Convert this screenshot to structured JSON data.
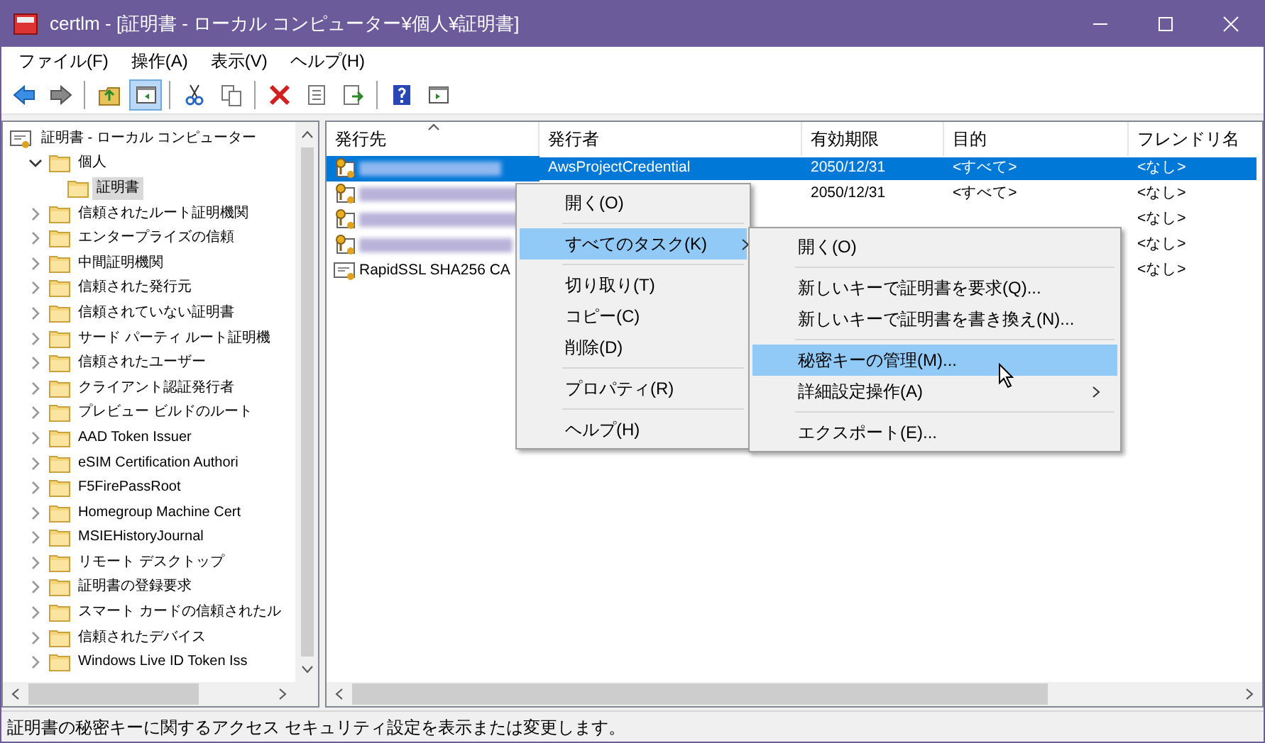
{
  "window": {
    "title": "certlm - [証明書 - ローカル コンピューター¥個人¥証明書]"
  },
  "menu_bar": [
    "ファイル(F)",
    "操作(A)",
    "表示(V)",
    "ヘルプ(H)"
  ],
  "toolbar": [
    {
      "kind": "back",
      "pressed": false
    },
    {
      "kind": "forward",
      "pressed": false
    },
    {
      "kind": "separator"
    },
    {
      "kind": "up",
      "pressed": false
    },
    {
      "kind": "tree",
      "pressed": true
    },
    {
      "kind": "separator"
    },
    {
      "kind": "cut",
      "pressed": false
    },
    {
      "kind": "copy",
      "pressed": false
    },
    {
      "kind": "separator"
    },
    {
      "kind": "delete",
      "pressed": false
    },
    {
      "kind": "properties",
      "pressed": false
    },
    {
      "kind": "export",
      "pressed": false
    },
    {
      "kind": "separator"
    },
    {
      "kind": "help",
      "pressed": false
    },
    {
      "kind": "action_pane",
      "pressed": false
    }
  ],
  "tree": [
    {
      "label": "証明書 - ローカル コンピューター",
      "kind": "root",
      "selected": false,
      "children": [
        {
          "label": "個人",
          "kind": "folder",
          "expanded": true,
          "selected": false,
          "children": [
            {
              "label": "証明書",
              "kind": "folder",
              "selected": true
            }
          ]
        },
        {
          "label": "信頼されたルート証明機関",
          "kind": "folder",
          "expanded": false,
          "selected": false
        },
        {
          "label": "エンタープライズの信頼",
          "kind": "folder",
          "expanded": false,
          "selected": false
        },
        {
          "label": "中間証明機関",
          "kind": "folder",
          "expanded": false,
          "selected": false
        },
        {
          "label": "信頼された発行元",
          "kind": "folder",
          "expanded": false,
          "selected": false
        },
        {
          "label": "信頼されていない証明書",
          "kind": "folder",
          "expanded": false,
          "selected": false
        },
        {
          "label": "サード パーティ ルート証明機",
          "kind": "folder",
          "expanded": false,
          "selected": false
        },
        {
          "label": "信頼されたユーザー",
          "kind": "folder",
          "expanded": false,
          "selected": false
        },
        {
          "label": "クライアント認証発行者",
          "kind": "folder",
          "expanded": false,
          "selected": false
        },
        {
          "label": "プレビュー ビルドのルート",
          "kind": "folder",
          "expanded": false,
          "selected": false
        },
        {
          "label": "AAD Token Issuer",
          "kind": "folder",
          "expanded": false,
          "selected": false
        },
        {
          "label": "eSIM Certification Authori",
          "kind": "folder",
          "expanded": false,
          "selected": false
        },
        {
          "label": "F5FirePassRoot",
          "kind": "folder",
          "expanded": false,
          "selected": false
        },
        {
          "label": "Homegroup Machine Cert",
          "kind": "folder",
          "expanded": false,
          "selected": false
        },
        {
          "label": "MSIEHistoryJournal",
          "kind": "folder",
          "expanded": false,
          "selected": false
        },
        {
          "label": "リモート デスクトップ",
          "kind": "folder",
          "expanded": false,
          "selected": false
        },
        {
          "label": "証明書の登録要求",
          "kind": "folder",
          "expanded": false,
          "selected": false
        },
        {
          "label": "スマート カードの信頼されたル",
          "kind": "folder",
          "expanded": false,
          "selected": false
        },
        {
          "label": "信頼されたデバイス",
          "kind": "folder",
          "expanded": false,
          "selected": false
        },
        {
          "label": "Windows Live ID Token Iss",
          "kind": "folder",
          "expanded": false,
          "selected": false
        }
      ]
    }
  ],
  "list": {
    "columns": [
      {
        "label": "発行先",
        "sorted": true
      },
      {
        "label": "発行者",
        "sorted": false
      },
      {
        "label": "有効期限",
        "sorted": false
      },
      {
        "label": "目的",
        "sorted": false
      },
      {
        "label": "フレンドリ名",
        "sorted": false
      }
    ],
    "rows": [
      {
        "selected": true,
        "has_private_key": true,
        "redacted": true,
        "issuer": "AwsProjectCredential",
        "expires": "2050/12/31",
        "purpose": "<すべて>",
        "friendly_name": "<なし>"
      },
      {
        "selected": false,
        "has_private_key": true,
        "redacted": true,
        "expires": "2050/12/31",
        "purpose": "<すべて>",
        "friendly_name": "<なし>"
      },
      {
        "selected": false,
        "has_private_key": true,
        "redacted": true,
        "friendly_name": "<なし>"
      },
      {
        "selected": false,
        "has_private_key": true,
        "redacted": true,
        "friendly_name": "<なし>"
      },
      {
        "selected": false,
        "has_private_key": false,
        "redacted": false,
        "issued_to": "RapidSSL SHA256 CA",
        "friendly_name": "<なし>"
      }
    ]
  },
  "context_menu": [
    {
      "kind": "item",
      "label": "開く(O)",
      "selected": false,
      "submenu": false
    },
    {
      "kind": "separator"
    },
    {
      "kind": "item",
      "label": "すべてのタスク(K)",
      "selected": true,
      "submenu": true
    },
    {
      "kind": "separator"
    },
    {
      "kind": "item",
      "label": "切り取り(T)",
      "selected": false,
      "submenu": false
    },
    {
      "kind": "item",
      "label": "コピー(C)",
      "selected": false,
      "submenu": false
    },
    {
      "kind": "item",
      "label": "削除(D)",
      "selected": false,
      "submenu": false
    },
    {
      "kind": "separator"
    },
    {
      "kind": "item",
      "label": "プロパティ(R)",
      "selected": false,
      "submenu": false
    },
    {
      "kind": "separator"
    },
    {
      "kind": "item",
      "label": "ヘルプ(H)",
      "selected": false,
      "submenu": false
    }
  ],
  "submenu": [
    {
      "kind": "item",
      "label": "開く(O)",
      "selected": false,
      "submenu": false
    },
    {
      "kind": "separator"
    },
    {
      "kind": "item",
      "label": "新しいキーで証明書を要求(Q)...",
      "selected": false,
      "submenu": false
    },
    {
      "kind": "item",
      "label": "新しいキーで証明書を書き換え(N)...",
      "selected": false,
      "submenu": false
    },
    {
      "kind": "separator"
    },
    {
      "kind": "item",
      "label": "秘密キーの管理(M)...",
      "selected": true,
      "submenu": false
    },
    {
      "kind": "item",
      "label": "詳細設定操作(A)",
      "selected": false,
      "submenu": true
    },
    {
      "kind": "separator"
    },
    {
      "kind": "item",
      "label": "エクスポート(E)...",
      "selected": false,
      "submenu": false
    }
  ],
  "status_bar": "証明書の秘密キーに関するアクセス セキュリティ設定を表示または変更します。"
}
